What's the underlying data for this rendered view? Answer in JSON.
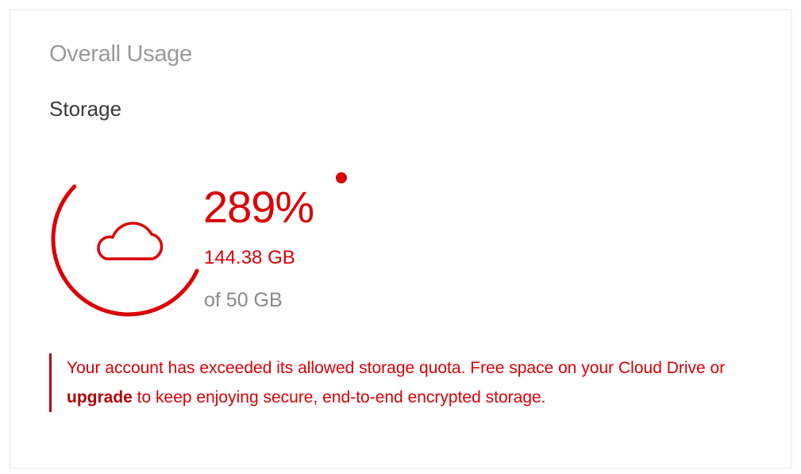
{
  "panel": {
    "title": "Overall Usage"
  },
  "storage": {
    "section_title": "Storage",
    "percent": "289%",
    "used": "144.38 GB",
    "total": "of 50 GB",
    "usage_fraction": 2.89,
    "icon": "cloud-icon",
    "accent_color": "#d90007"
  },
  "warning": {
    "text_before": "Your account has exceeded its allowed storage quota. Free space on your Cloud Drive or ",
    "link_label": "upgrade",
    "text_after": " to keep enjoying secure, end-to-end encrypted storage."
  }
}
